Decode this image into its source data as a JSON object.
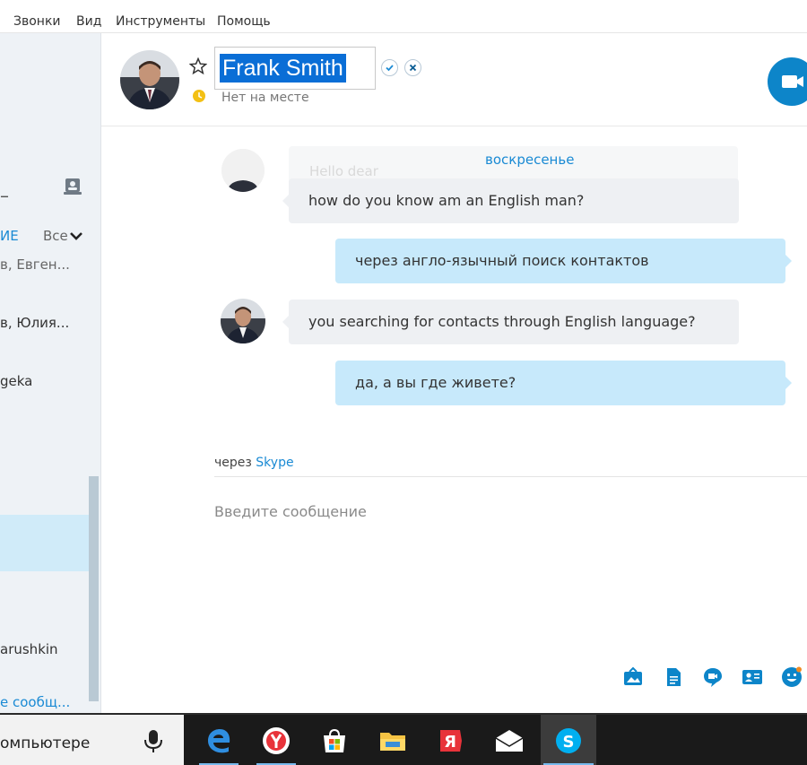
{
  "menu": {
    "items": [
      "Звонки",
      "Вид",
      "Инструменты",
      "Помощь"
    ]
  },
  "sidebar": {
    "dash": "–",
    "tab_active": "ИЕ",
    "filter_label": "Все",
    "items": [
      "в, Евген...",
      "в, Юлия...",
      "geka",
      "arushkin"
    ],
    "link": "е сообщ..."
  },
  "header": {
    "contact_name": "Frank Smith",
    "status": "Нет на месте",
    "status_color": "#f3c014"
  },
  "conversation": {
    "date": "воскресенье",
    "ghost_message": "Hello dear",
    "messages": [
      {
        "dir": "in",
        "text": "how do you know am an English man?"
      },
      {
        "dir": "out",
        "text": "через англо-язычный поиск контактов"
      },
      {
        "dir": "in",
        "text": "you searching for contacts through English language?"
      },
      {
        "dir": "out",
        "text": "да, а вы где живете?"
      }
    ]
  },
  "compose": {
    "via_prefix": "через",
    "via_service": "Skype",
    "placeholder": "Введите сообщение"
  },
  "taskbar": {
    "search_text": "омпьютере",
    "apps": [
      "edge",
      "yandex-browser",
      "store",
      "file-explorer",
      "yandex",
      "mail",
      "skype"
    ]
  },
  "colors": {
    "accent": "#0d85c9",
    "outgoing_bubble": "#c7e9fb",
    "incoming_bubble": "#eef0f3",
    "selection": "#0a6ed6"
  }
}
